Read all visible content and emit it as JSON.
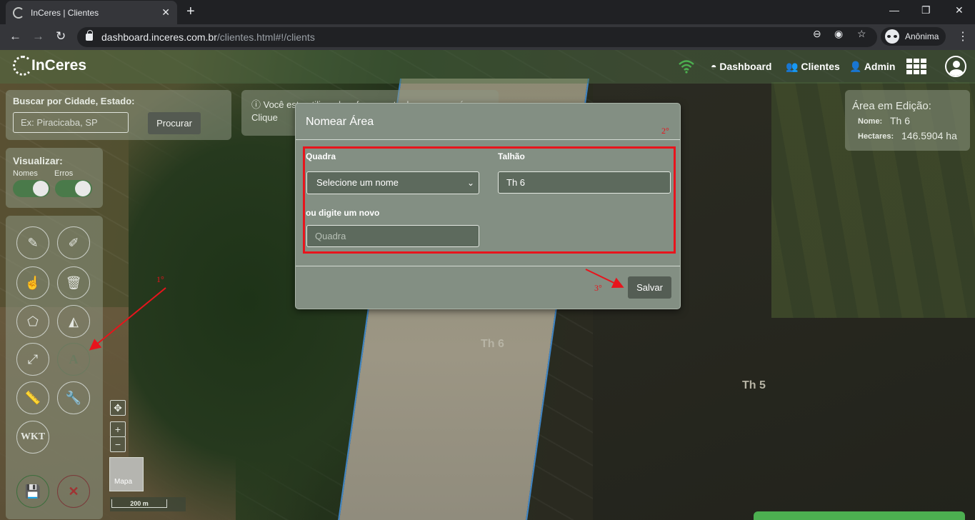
{
  "browser": {
    "tab_title": "InCeres | Clientes",
    "tab_close": "✕",
    "new_tab": "+",
    "url_host": "dashboard.inceres.com.br",
    "url_path": "/clientes.html#!/clients",
    "profile_label": "Anônima"
  },
  "app": {
    "logo_text": "InCeres",
    "nav": {
      "dashboard": "Dashboard",
      "clientes": "Clientes",
      "admin": "Admin"
    },
    "accent_green": "#4caf50"
  },
  "search_panel": {
    "label": "Buscar por Cidade, Estado:",
    "placeholder": "Ex: Piracicaba, SP",
    "button": "Procurar"
  },
  "info_panel": {
    "text": "Você esta utilizando a ferramenta de renomear área. Clique"
  },
  "view_panel": {
    "title": "Visualizar:",
    "toggle_names": "Nomes",
    "toggle_errors": "Erros"
  },
  "tools": {
    "wkt": "WKT",
    "text_tool": "A"
  },
  "map": {
    "scale": "200 m",
    "minimap_label": "Mapa",
    "labels": [
      "Th 6",
      "Th 5"
    ]
  },
  "area_panel": {
    "title": "Área em Edição:",
    "name_key": "Nome:",
    "name_val": "Th 6",
    "hectares_key": "Hectares:",
    "hectares_val": "146.5904 ha"
  },
  "modal": {
    "title": "Nomear Área",
    "quadra_label": "Quadra",
    "quadra_select": "Selecione um nome",
    "talhao_label": "Talhão",
    "talhao_value": "Th 6",
    "new_label": "ou digite um novo",
    "new_placeholder": "Quadra",
    "save_button": "Salvar"
  },
  "annotations": {
    "step1": "1°",
    "step2": "2°",
    "step3": "3°",
    "color": "#e8141c"
  }
}
